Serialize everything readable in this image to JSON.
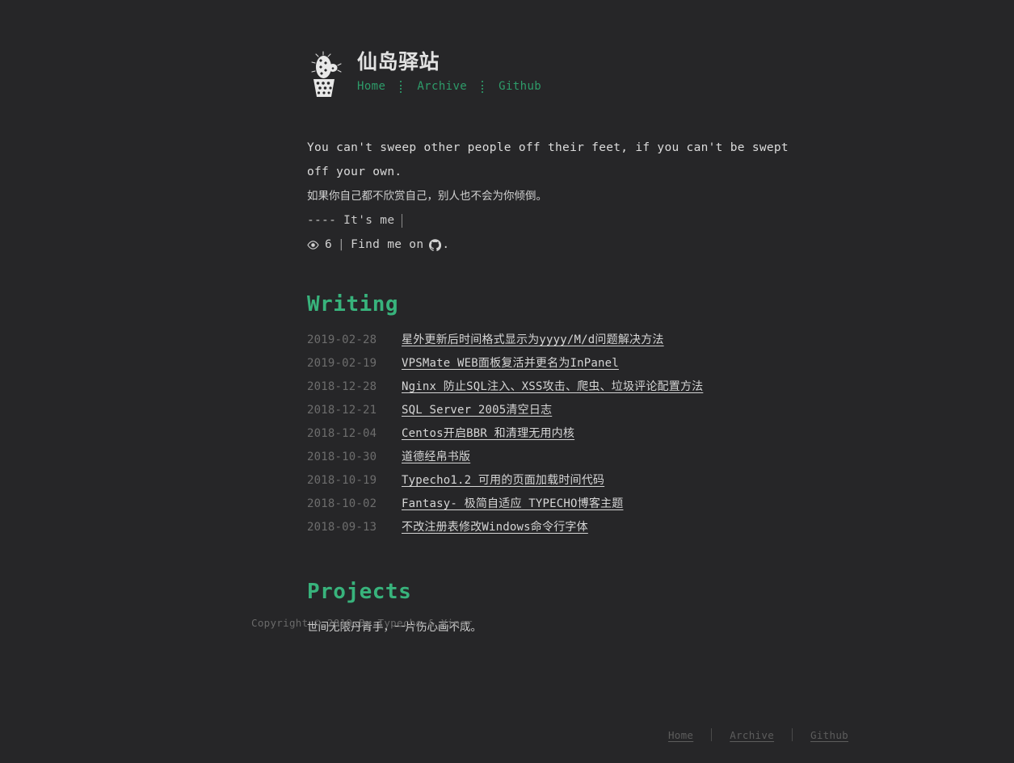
{
  "theme": {
    "background": "#262628",
    "accent_green": "#38b37c",
    "nav_green": "#2e9c6a",
    "text": "#d8d8d8",
    "muted": "#6d6d6d"
  },
  "header": {
    "logo_icon": "cactus-in-pot-icon",
    "site_title": "仙岛驿站",
    "nav": [
      {
        "label": "Home"
      },
      {
        "label": "Archive"
      },
      {
        "label": "Github"
      }
    ]
  },
  "quote": {
    "english": "You can't sweep other people off their feet, if you can't be swept off your own.",
    "chinese": "如果你自己都不欣赏自己，别人也不会为你倾倒。",
    "signature": "---- It's me",
    "views_icon": "eye-icon",
    "views_count": "6",
    "separator": "|",
    "find_me_text": "Find me on",
    "github_icon": "github-icon",
    "find_me_period": "."
  },
  "writing": {
    "title": "Writing",
    "posts": [
      {
        "date": "2019-02-28",
        "title": "星外更新后时间格式显示为yyyy/M/d问题解决方法"
      },
      {
        "date": "2019-02-19",
        "title": "VPSMate WEB面板复活并更名为InPanel"
      },
      {
        "date": "2018-12-28",
        "title": "Nginx 防止SQL注入、XSS攻击、爬虫、垃圾评论配置方法"
      },
      {
        "date": "2018-12-21",
        "title": "SQL Server 2005清空日志"
      },
      {
        "date": "2018-12-04",
        "title": "Centos开启BBR 和清理无用内核"
      },
      {
        "date": "2018-10-30",
        "title": "道德经帛书版"
      },
      {
        "date": "2018-10-19",
        "title": "Typecho1.2 可用的页面加载时间代码"
      },
      {
        "date": "2018-10-02",
        "title": "Fantasy- 极简自适应 TYPECHO博客主题"
      },
      {
        "date": "2018-09-13",
        "title": "不改注册表修改Windows命令行字体"
      }
    ]
  },
  "projects": {
    "title": "Projects",
    "text": "世间无限丹青手，一片伤心画不成。"
  },
  "footer": {
    "copyright": "Copyright © 2019 By Typecho & Xingr",
    "links": [
      {
        "label": "Home"
      },
      {
        "label": "Archive"
      },
      {
        "label": "Github"
      }
    ]
  }
}
